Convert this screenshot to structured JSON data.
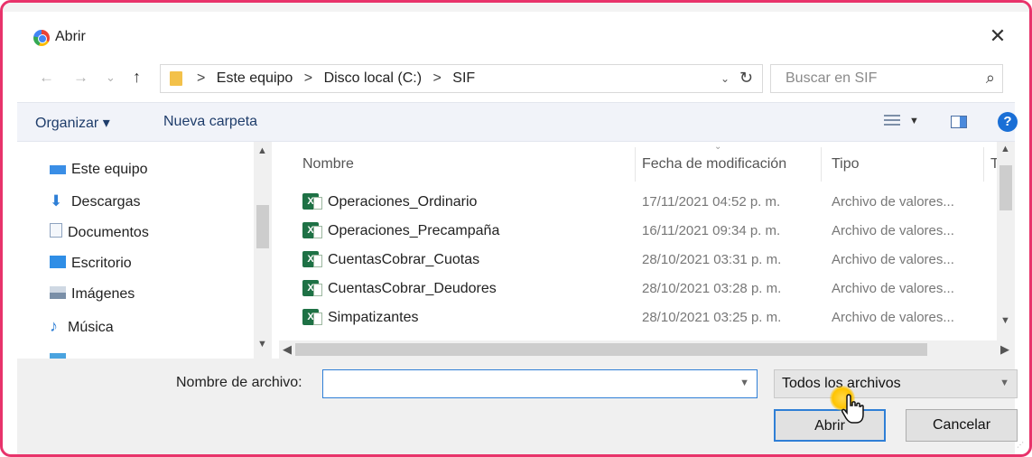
{
  "window": {
    "title": "Abrir",
    "close_glyph": "✕"
  },
  "nav": {
    "back_glyph": "←",
    "forward_glyph": "→",
    "recent_glyph": "⌄",
    "up_glyph": "↑",
    "breadcrumbs": [
      "Este equipo",
      "Disco local (C:)",
      "SIF"
    ],
    "separator": ">",
    "refresh_glyph": "↻",
    "search_placeholder": "Buscar en SIF"
  },
  "toolbar": {
    "organize_label": "Organizar ▾",
    "new_folder_label": "Nueva carpeta",
    "help_glyph": "?"
  },
  "sidebar": {
    "items": [
      {
        "label": "Este equipo",
        "icon": "computer-icon",
        "color": "#3a8ee6"
      },
      {
        "label": "Descargas",
        "icon": "download-icon",
        "color": "#2f7fd6"
      },
      {
        "label": "Documentos",
        "icon": "documents-icon",
        "color": "#8ea3bf"
      },
      {
        "label": "Escritorio",
        "icon": "desktop-icon",
        "color": "#2f8ee6"
      },
      {
        "label": "Imágenes",
        "icon": "pictures-icon",
        "color": "#7a8fa8"
      },
      {
        "label": "Música",
        "icon": "music-icon",
        "color": "#2f7fd6"
      }
    ]
  },
  "columns": {
    "name": "Nombre",
    "date": "Fecha de modificación",
    "type": "Tipo",
    "size": "Tam"
  },
  "files": [
    {
      "name": "Operaciones_Ordinario",
      "date": "17/11/2021 04:52 p. m.",
      "type": "Archivo de valores..."
    },
    {
      "name": "Operaciones_Precampaña",
      "date": "16/11/2021 09:34 p. m.",
      "type": "Archivo de valores..."
    },
    {
      "name": "CuentasCobrar_Cuotas",
      "date": "28/10/2021 03:31 p. m.",
      "type": "Archivo de valores..."
    },
    {
      "name": "CuentasCobrar_Deudores",
      "date": "28/10/2021 03:28 p. m.",
      "type": "Archivo de valores..."
    },
    {
      "name": "Simpatizantes",
      "date": "28/10/2021 03:25 p. m.",
      "type": "Archivo de valores..."
    }
  ],
  "bottom": {
    "filename_label": "Nombre de archivo:",
    "filename_value": "",
    "filetype_value": "Todos los archivos",
    "open_label": "Abrir",
    "cancel_label": "Cancelar"
  },
  "colors": {
    "frame_border": "#e8336b",
    "accent": "#2f7fd6",
    "excel_green": "#1e7145",
    "cursor_highlight": "#ffc400"
  }
}
